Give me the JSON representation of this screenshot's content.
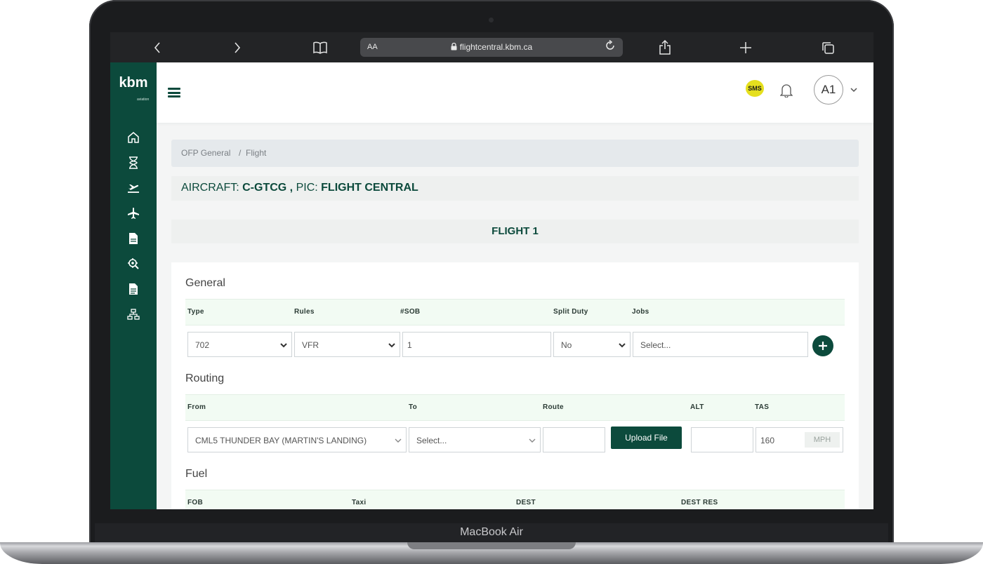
{
  "device": {
    "label": "MacBook Air"
  },
  "browser": {
    "url_text": "flightcentral.kbm.ca",
    "text_size_label": "AA",
    "icons": [
      "chevron-left-icon",
      "chevron-right-icon",
      "book-icon",
      "lock-icon",
      "reload-icon",
      "share-icon",
      "plus-icon",
      "tabs-icon"
    ]
  },
  "app": {
    "logo": "kbm",
    "logo_sub": "aviation",
    "sidebar_icons": [
      "home-icon",
      "hourglass-icon",
      "departure-icon",
      "airplane-icon",
      "document-icon",
      "gear-search-icon",
      "report-icon",
      "org-chart-icon"
    ],
    "header": {
      "sms_badge": "SMS",
      "avatar": "A1"
    }
  },
  "breadcrumb": {
    "first": "OFP General",
    "separator": "/",
    "current": "Flight"
  },
  "aircraft": {
    "aircraft_label": "AIRCRAFT:",
    "aircraft_value": "C-GTCG ,",
    "pic_label": "PIC:",
    "pic_value": "FLIGHT CENTRAL"
  },
  "flight": {
    "title": "FLIGHT 1"
  },
  "general": {
    "title": "General",
    "headers": {
      "type": "Type",
      "rules": "Rules",
      "sob": "#SOB",
      "split_duty": "Split Duty",
      "jobs": "Jobs"
    },
    "values": {
      "type": "702",
      "rules": "VFR",
      "sob": "1",
      "split_duty": "No",
      "jobs_placeholder": "Select..."
    }
  },
  "routing": {
    "title": "Routing",
    "headers": {
      "from": "From",
      "to": "To",
      "route": "Route",
      "alt": "ALT",
      "tas": "TAS"
    },
    "values": {
      "from": "CML5 THUNDER BAY (MARTIN'S LANDING)",
      "to_placeholder": "Select...",
      "route": "",
      "upload": "Upload File",
      "alt": "",
      "tas": "160",
      "tas_unit": "MPH"
    }
  },
  "fuel": {
    "title": "Fuel",
    "headers": {
      "fob": "FOB",
      "taxi": "Taxi",
      "dest": "DEST",
      "dest_res": "DEST RES"
    }
  },
  "colors": {
    "brand": "#0c4a3c",
    "header_row": "#f2fbf3",
    "sms": "#e5df1e"
  }
}
